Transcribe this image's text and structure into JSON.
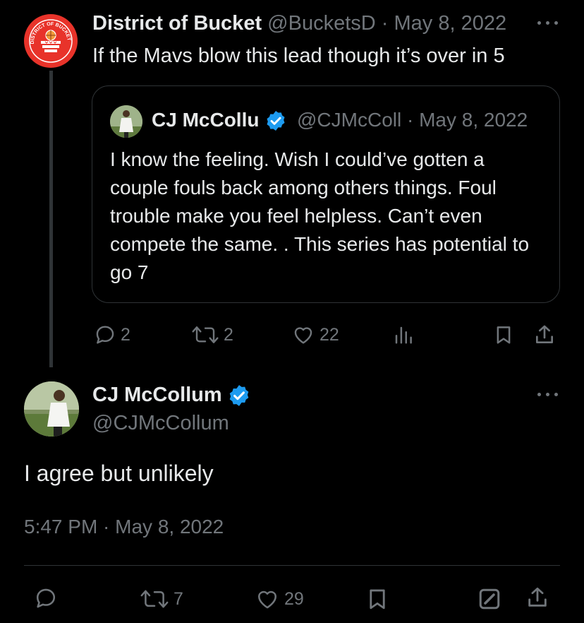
{
  "parent_tweet": {
    "author_name": "District of Bucket",
    "handle": "@BucketsD",
    "separator": "·",
    "date": "May 8, 2022",
    "text": "If the Mavs blow this lead though it’s over in 5",
    "avatar_icon": "district-of-buckets-logo",
    "avatar_logo_text": "DISTRICT OF BUCKETS",
    "brand_color": "#e8332a",
    "quoted_tweet": {
      "author_name": "CJ McCollu",
      "handle": "@CJMcColl",
      "separator": "·",
      "date": "May 8, 2022",
      "verified": true,
      "text": "I know the feeling. Wish I could’ve gotten a couple fouls back among others things. Foul trouble make you feel helpless. Can’t even compete the same. . This series has potential to go 7"
    },
    "actions": {
      "replies": "2",
      "retweets": "2",
      "likes": "22",
      "icons": [
        "reply-icon",
        "retweet-icon",
        "like-icon",
        "views-icon",
        "bookmark-icon",
        "share-icon"
      ]
    }
  },
  "main_tweet": {
    "author_name": "CJ McCollum",
    "handle": "@CJMcCollum",
    "verified": true,
    "text": "I agree but unlikely",
    "timestamp": "5:47 PM · May 8, 2022",
    "actions": {
      "retweets": "7",
      "likes": "29",
      "icons": [
        "reply-icon",
        "retweet-icon",
        "like-icon",
        "bookmark-icon",
        "edit-icon",
        "share-icon"
      ]
    }
  },
  "colors": {
    "background": "#000000",
    "text_primary": "#e7e9ea",
    "text_muted": "#71767b",
    "verified_badge": "#1d9bf0",
    "border": "#2f3336"
  }
}
